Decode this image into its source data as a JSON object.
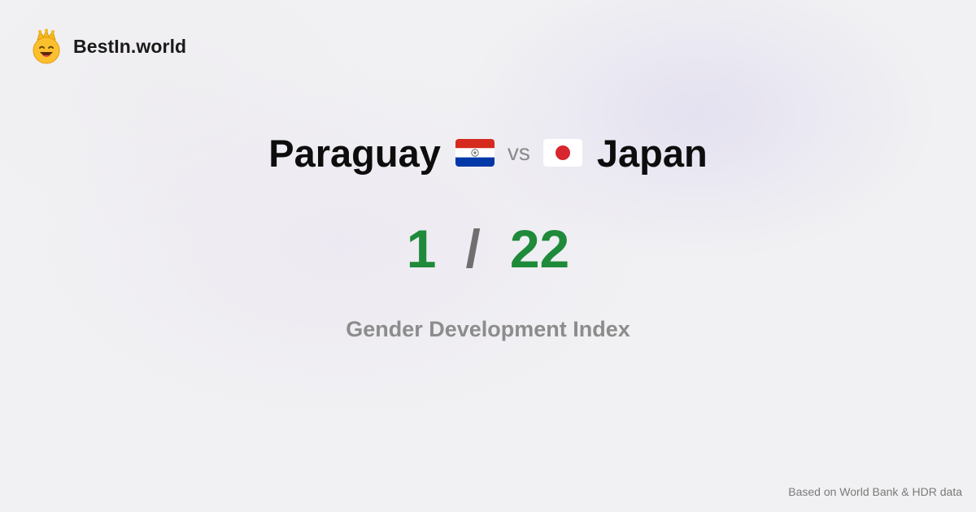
{
  "brand": {
    "name": "BestIn.world",
    "logo_icon": "smiling-crown-emoji-icon"
  },
  "comparison": {
    "left_country": "Paraguay",
    "left_flag_icon": "paraguay-flag-icon",
    "vs_label": "vs",
    "right_country": "Japan",
    "right_flag_icon": "japan-flag-icon"
  },
  "scores": {
    "left_rank": "1",
    "separator": "/",
    "right_rank": "22",
    "color": "#1f8a3a"
  },
  "metric": {
    "name": "Gender Development Index"
  },
  "footer": {
    "source": "Based on World Bank & HDR data"
  }
}
